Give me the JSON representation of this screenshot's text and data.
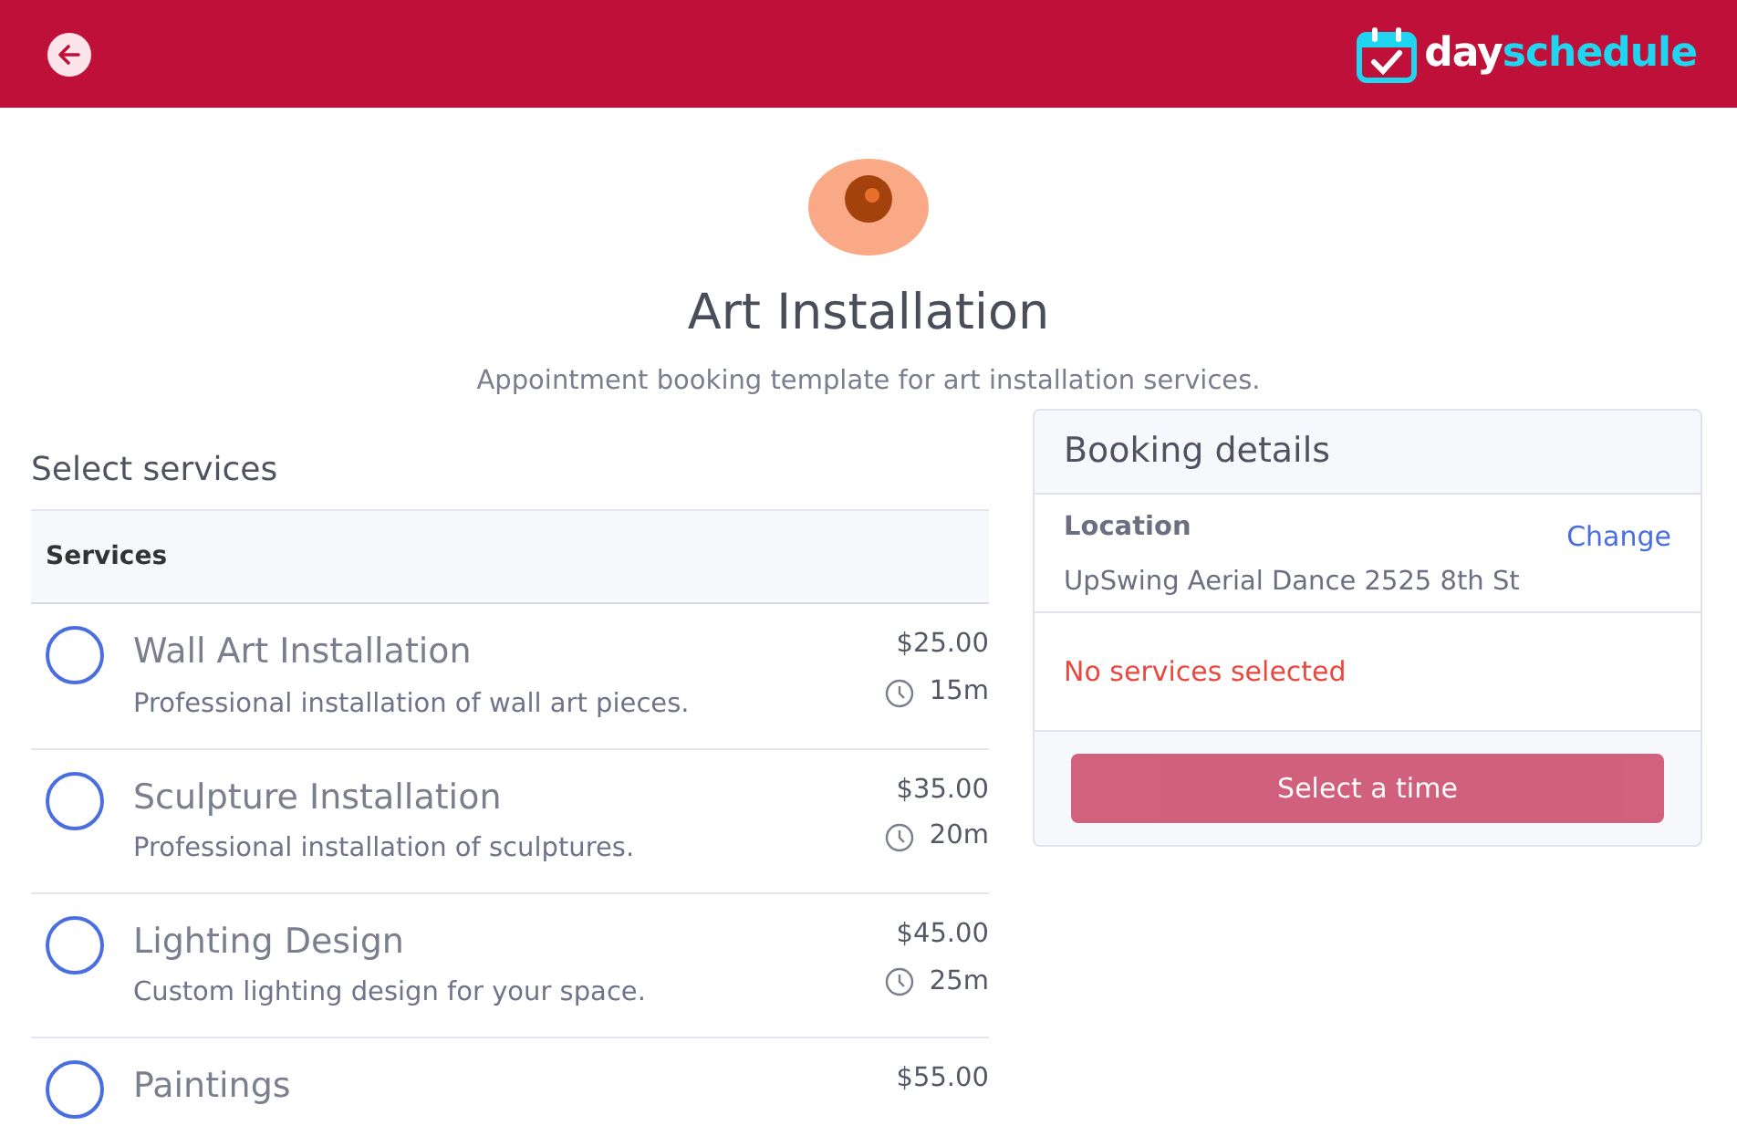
{
  "header": {
    "brand": {
      "part_1": "day",
      "part_2": "schedule"
    }
  },
  "title": "Art Installation",
  "subtitle": "Appointment booking template for art installation services.",
  "services_section": {
    "heading": "Select services",
    "table_header": "Services",
    "services": [
      {
        "name": "Wall Art Installation",
        "description": "Professional installation of wall art pieces.",
        "price": "$25.00",
        "duration": "15m",
        "selected": false
      },
      {
        "name": "Sculpture Installation",
        "description": "Professional installation of sculptures.",
        "price": "$35.00",
        "duration": "20m",
        "selected": false
      },
      {
        "name": "Lighting Design",
        "description": "Custom lighting design for your space.",
        "price": "$45.00",
        "duration": "25m",
        "selected": false
      },
      {
        "name": "Paintings",
        "price": "$55.00",
        "selected": false
      }
    ]
  },
  "booking": {
    "title": "Booking details",
    "location_label": "Location",
    "change_link": "Change",
    "location": "UpSwing Aerial Dance 2525 8th St",
    "status": "No services selected",
    "button": {
      "label": "Select a time",
      "disabled": true
    }
  }
}
